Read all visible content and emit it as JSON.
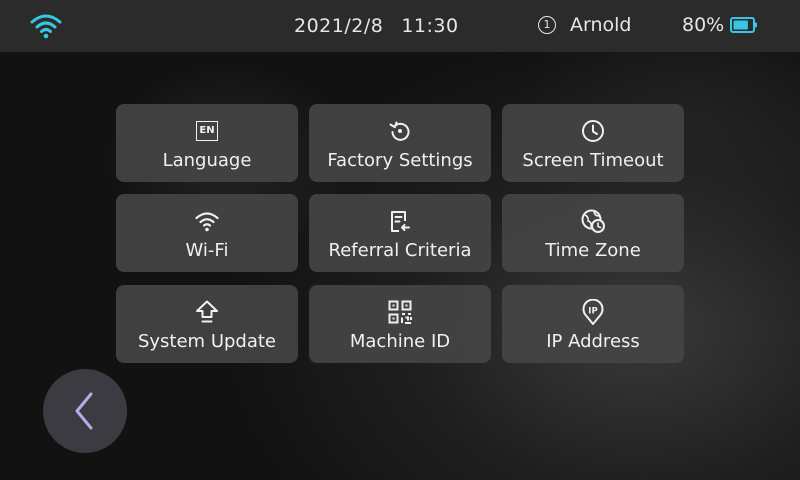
{
  "status_bar": {
    "date": "2021/2/8",
    "time": "11:30",
    "user_icon_glyph": "1",
    "user_name": "Arnold",
    "battery_percent": "80%",
    "battery_level": 0.8,
    "accent_color": "#37c6e6",
    "wifi_icon": "wifi-icon"
  },
  "settings": {
    "tiles": [
      {
        "label": "Language",
        "icon": "language-en-icon",
        "badge": "EN"
      },
      {
        "label": "Factory Settings",
        "icon": "reset-icon"
      },
      {
        "label": "Screen Timeout",
        "icon": "clock-icon"
      },
      {
        "label": "Wi-Fi",
        "icon": "wifi-icon"
      },
      {
        "label": "Referral Criteria",
        "icon": "document-icon"
      },
      {
        "label": "Time Zone",
        "icon": "globe-clock-icon"
      },
      {
        "label": "System Update",
        "icon": "upload-arrow-icon"
      },
      {
        "label": "Machine ID",
        "icon": "qr-code-icon"
      },
      {
        "label": "IP Address",
        "icon": "ip-pin-icon",
        "badge": "IP"
      }
    ]
  },
  "navigation": {
    "back_icon": "chevron-left-icon",
    "back_color": "#b9a9e6"
  }
}
